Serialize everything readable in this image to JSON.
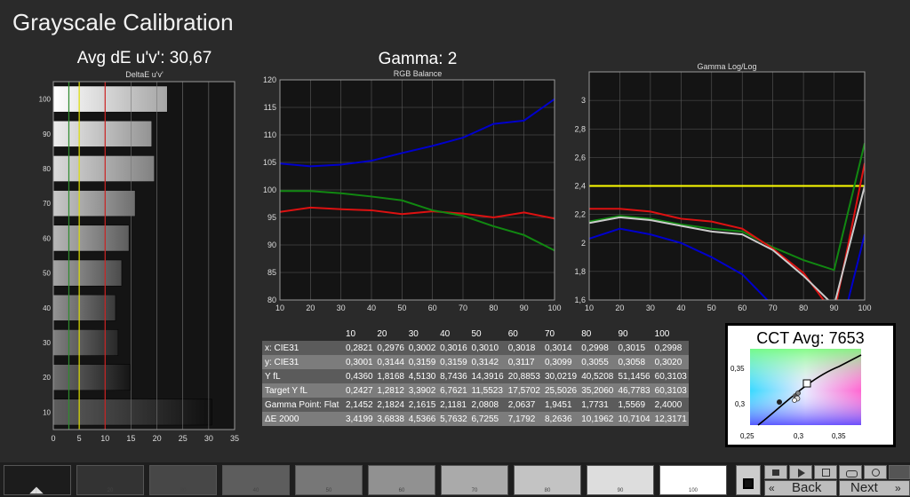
{
  "page": {
    "title": "Grayscale Calibration"
  },
  "delta_e": {
    "heading": "Avg dE u'v': 30,67",
    "subtitle": "DeltaE u'v'"
  },
  "gamma": {
    "heading": "Gamma: 2"
  },
  "rgb_balance": {
    "subtitle": "RGB Balance"
  },
  "gamma_log": {
    "subtitle": "Gamma Log/Log"
  },
  "chart_data": [
    {
      "type": "bar",
      "orientation": "horizontal",
      "title": "DeltaE u'v'",
      "categories": [
        "100",
        "90",
        "80",
        "70",
        "60",
        "50",
        "40",
        "30",
        "20",
        "10"
      ],
      "values": [
        22,
        19,
        19.5,
        15.8,
        14.6,
        13.2,
        12,
        12.5,
        14.8,
        30.6
      ],
      "xlim": [
        0,
        35
      ],
      "xticks": [
        "0",
        "5",
        "10",
        "15",
        "20",
        "25",
        "30",
        "35"
      ],
      "reference_lines": [
        {
          "x": 3,
          "color": "#2e8b2e"
        },
        {
          "x": 5,
          "color": "#e0e000"
        },
        {
          "x": 10,
          "color": "#cc2222"
        }
      ],
      "grid": true
    },
    {
      "type": "line",
      "title": "RGB Balance",
      "x": [
        10,
        20,
        30,
        40,
        50,
        60,
        70,
        80,
        90,
        100
      ],
      "ylim": [
        80,
        120
      ],
      "xticks": [
        "10",
        "20",
        "30",
        "40",
        "50",
        "60",
        "70",
        "80",
        "90",
        "100"
      ],
      "yticks": [
        "80",
        "85",
        "90",
        "95",
        "100",
        "105",
        "110",
        "115",
        "120"
      ],
      "grid": true,
      "series": [
        {
          "color": "#dd1111",
          "values": [
            96,
            96.8,
            96.5,
            96.3,
            95.6,
            96.1,
            95.7,
            95,
            95.9,
            94.8
          ]
        },
        {
          "color": "#118811",
          "values": [
            99.8,
            99.8,
            99.4,
            98.8,
            98.1,
            96.3,
            95.3,
            93.4,
            91.8,
            89
          ]
        },
        {
          "color": "#0000cc",
          "values": [
            104.8,
            104.3,
            104.6,
            105.3,
            106.7,
            108,
            109.5,
            112,
            112.6,
            116.5
          ]
        }
      ]
    },
    {
      "type": "line",
      "title": "Gamma Log/Log",
      "x": [
        10,
        20,
        30,
        40,
        50,
        60,
        70,
        80,
        90,
        100
      ],
      "ylim": [
        1.6,
        3.2
      ],
      "xticks": [
        "10",
        "20",
        "30",
        "40",
        "50",
        "60",
        "70",
        "80",
        "90",
        "100"
      ],
      "yticks": [
        "1,6",
        "1,8",
        "2",
        "2,2",
        "2,4",
        "2,6",
        "2,8",
        "3"
      ],
      "grid": true,
      "series": [
        {
          "color": "#ffff00",
          "values": [
            2.4,
            2.4,
            2.4,
            2.4,
            2.4,
            2.4,
            2.4,
            2.4,
            2.4,
            2.4
          ]
        },
        {
          "color": "#118811",
          "values": [
            2.15,
            2.19,
            2.17,
            2.13,
            2.1,
            2.08,
            1.97,
            1.88,
            1.81,
            2.7
          ]
        },
        {
          "color": "#dd1111",
          "values": [
            2.24,
            2.24,
            2.22,
            2.17,
            2.15,
            2.1,
            1.96,
            1.79,
            1.5,
            2.56
          ]
        },
        {
          "color": "#0000cc",
          "values": [
            2.03,
            2.1,
            2.06,
            2.0,
            1.9,
            1.78,
            1.56,
            1.3,
            1.2,
            2.06
          ]
        },
        {
          "color": "#cccccc",
          "values": [
            2.14,
            2.18,
            2.16,
            2.12,
            2.08,
            2.06,
            1.95,
            1.77,
            1.56,
            2.4
          ]
        }
      ]
    }
  ],
  "table": {
    "header": [
      "",
      "10",
      "20",
      "30",
      "40",
      "50",
      "60",
      "70",
      "80",
      "90",
      "100"
    ],
    "rows": [
      {
        "label": "x: CIE31",
        "values": [
          "0,2821",
          "0,2976",
          "0,3002",
          "0,3016",
          "0,3010",
          "0,3018",
          "0,3014",
          "0,2998",
          "0,3015",
          "0,2998"
        ]
      },
      {
        "label": "y: CIE31",
        "values": [
          "0,3001",
          "0,3144",
          "0,3159",
          "0,3159",
          "0,3142",
          "0,3117",
          "0,3099",
          "0,3055",
          "0,3058",
          "0,3020"
        ]
      },
      {
        "label": "Y fL",
        "values": [
          "0,4360",
          "1,8168",
          "4,5130",
          "8,7436",
          "14,3916",
          "20,8853",
          "30,0219",
          "40,5208",
          "51,1456",
          "60,3103"
        ]
      },
      {
        "label": "Target Y fL",
        "values": [
          "0,2427",
          "1,2812",
          "3,3902",
          "6,7621",
          "11,5523",
          "17,5702",
          "25,5026",
          "35,2060",
          "46,7783",
          "60,3103"
        ]
      },
      {
        "label": "Gamma Point: Flat",
        "values": [
          "2,1452",
          "2,1824",
          "2,1615",
          "2,1181",
          "2,0808",
          "2,0637",
          "1,9451",
          "1,7731",
          "1,5569",
          "2,4000"
        ]
      },
      {
        "label": "ΔE 2000",
        "values": [
          "3,4199",
          "3,6838",
          "4,5366",
          "5,7632",
          "6,7255",
          "7,1792",
          "8,2636",
          "10,1962",
          "10,7104",
          "12,3171"
        ]
      }
    ]
  },
  "cct": {
    "heading": "CCT Avg: 7653",
    "yticks": [
      "0,35",
      "0,3"
    ],
    "xticks": [
      "0,25",
      "0,3",
      "0,35"
    ]
  },
  "patches": [
    {
      "label": "",
      "color": "#1c1c1c"
    },
    {
      "label": "20",
      "color": "#333333"
    },
    {
      "label": "30",
      "color": "#474747"
    },
    {
      "label": "40",
      "color": "#5d5d5d"
    },
    {
      "label": "50",
      "color": "#777777"
    },
    {
      "label": "60",
      "color": "#919191"
    },
    {
      "label": "70",
      "color": "#aaaaaa"
    },
    {
      "label": "80",
      "color": "#c3c3c3"
    },
    {
      "label": "90",
      "color": "#dddddd"
    },
    {
      "label": "100",
      "color": "#ffffff"
    }
  ],
  "nav": {
    "back": "Back",
    "next": "Next"
  }
}
